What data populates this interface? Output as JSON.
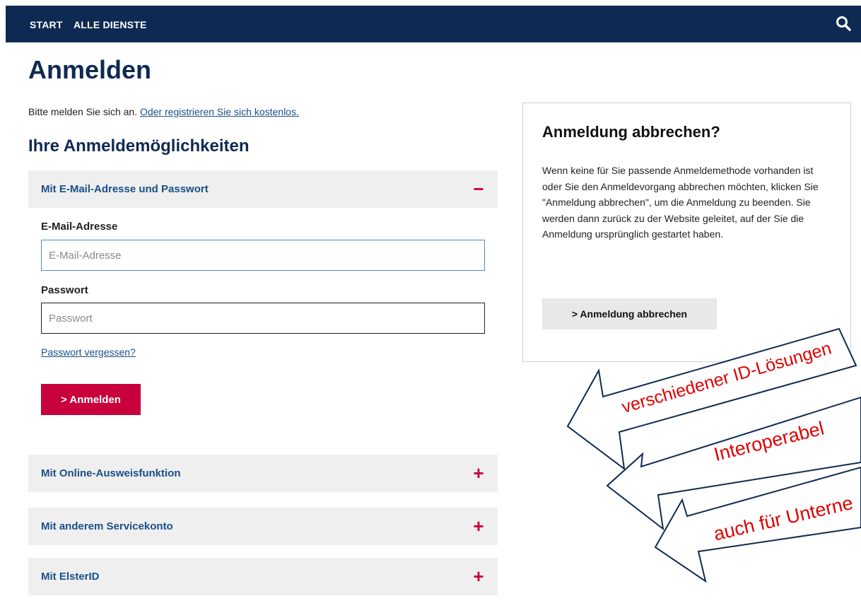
{
  "nav": {
    "start": "START",
    "all_services": "ALLE DIENSTE"
  },
  "page": {
    "title": "Anmelden",
    "intro_text": "Bitte melden Sie sich an.",
    "register_link": "Oder registrieren Sie sich kostenlos.",
    "options_title": "Ihre Anmeldemöglichkeiten"
  },
  "accordion": {
    "email": {
      "label": "Mit E-Mail-Adresse und Passwort",
      "toggle": "−"
    },
    "online_id": {
      "label": "Mit Online-Ausweisfunktion",
      "toggle": "+"
    },
    "other_account": {
      "label": "Mit anderem Servicekonto",
      "toggle": "+"
    },
    "elster": {
      "label": "Mit ElsterID",
      "toggle": "+"
    }
  },
  "form": {
    "email_label": "E-Mail-Adresse",
    "email_placeholder": "E-Mail-Adresse",
    "password_label": "Passwort",
    "password_placeholder": "Passwort",
    "forgot": "Passwort vergessen?",
    "submit": "> Anmelden"
  },
  "sidebar": {
    "title": "Anmeldung abbrechen?",
    "text": "Wenn keine für Sie passende Anmeldemethode vorhanden ist oder Sie den Anmeldevorgang abbrechen möchten, klicken Sie \"Anmeldung abbrechen\", um die Anmeldung zu beenden. Sie werden dann zurück zu der Website geleitet, auf der Sie die Anmeldung ursprünglich gestartet haben.",
    "button": "> Anmeldung abbrechen"
  },
  "annotations": {
    "arrow1": "verschiedener ID-Lösungen",
    "arrow2": "Interoperabel",
    "arrow3": "auch für Unterne"
  },
  "colors": {
    "navy": "#0f2a52",
    "accent": "#c8003c",
    "link": "#1a4f8a",
    "annotation": "#e00000"
  }
}
